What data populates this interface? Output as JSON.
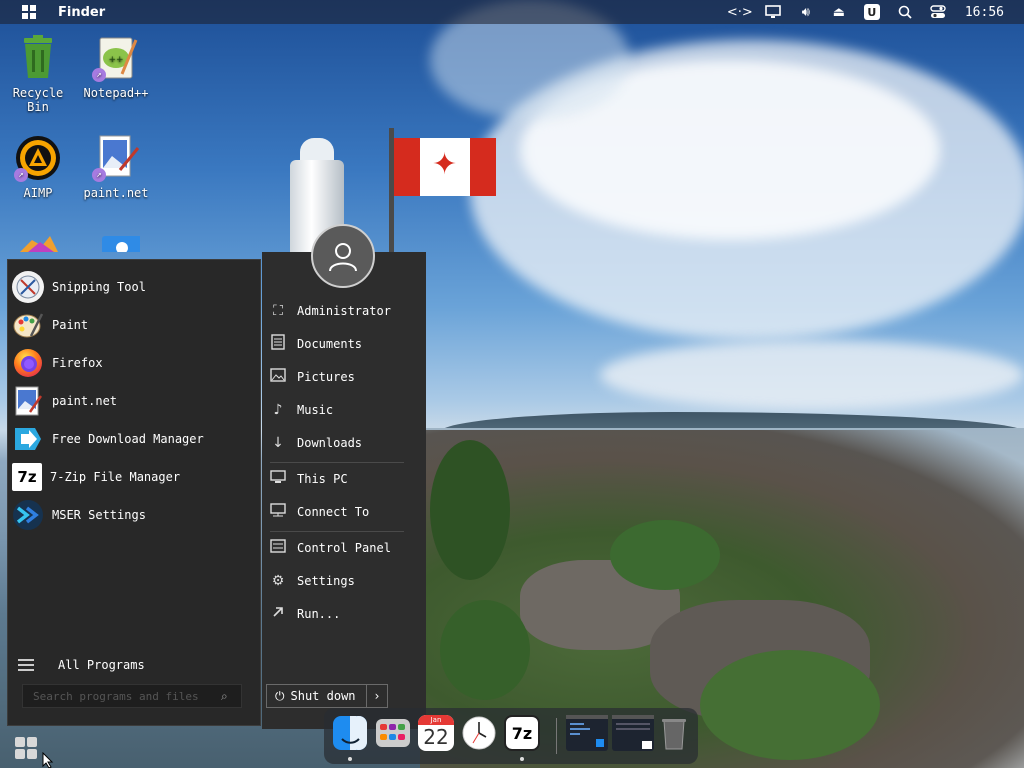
{
  "topbar": {
    "app_name": "Finder",
    "clock": "16:56",
    "tray_icons": [
      "network-icon",
      "display-icon",
      "volume-icon",
      "eject-icon",
      "u-icon",
      "search-icon",
      "control-center-icon"
    ],
    "u_label": "U"
  },
  "desktop": {
    "icons": [
      {
        "label": "Recycle Bin"
      },
      {
        "label": "Notepad++"
      },
      {
        "label": "AIMP"
      },
      {
        "label": "paint.net"
      }
    ]
  },
  "start_menu": {
    "programs": [
      {
        "label": "Snipping Tool"
      },
      {
        "label": "Paint"
      },
      {
        "label": "Firefox"
      },
      {
        "label": "paint.net"
      },
      {
        "label": "Free Download Manager"
      },
      {
        "label": "7-Zip File Manager"
      },
      {
        "label": "MSER Settings"
      }
    ],
    "all_programs": "All Programs",
    "search_placeholder": "Search programs and files",
    "places": [
      {
        "label": "Administrator"
      },
      {
        "label": "Documents"
      },
      {
        "label": "Pictures"
      },
      {
        "label": "Music"
      },
      {
        "label": "Downloads"
      },
      {
        "label": "This PC"
      },
      {
        "label": "Connect To"
      },
      {
        "label": "Control Panel"
      },
      {
        "label": "Settings"
      },
      {
        "label": "Run..."
      }
    ],
    "shutdown_label": "Shut down",
    "seven_zip_icon": "7z"
  },
  "dock": {
    "calendar_month": "Jan",
    "calendar_day": "22",
    "seven_zip_label": "7z"
  },
  "colors": {
    "menu_bg": "#282828",
    "accent": "#d52b1e"
  }
}
